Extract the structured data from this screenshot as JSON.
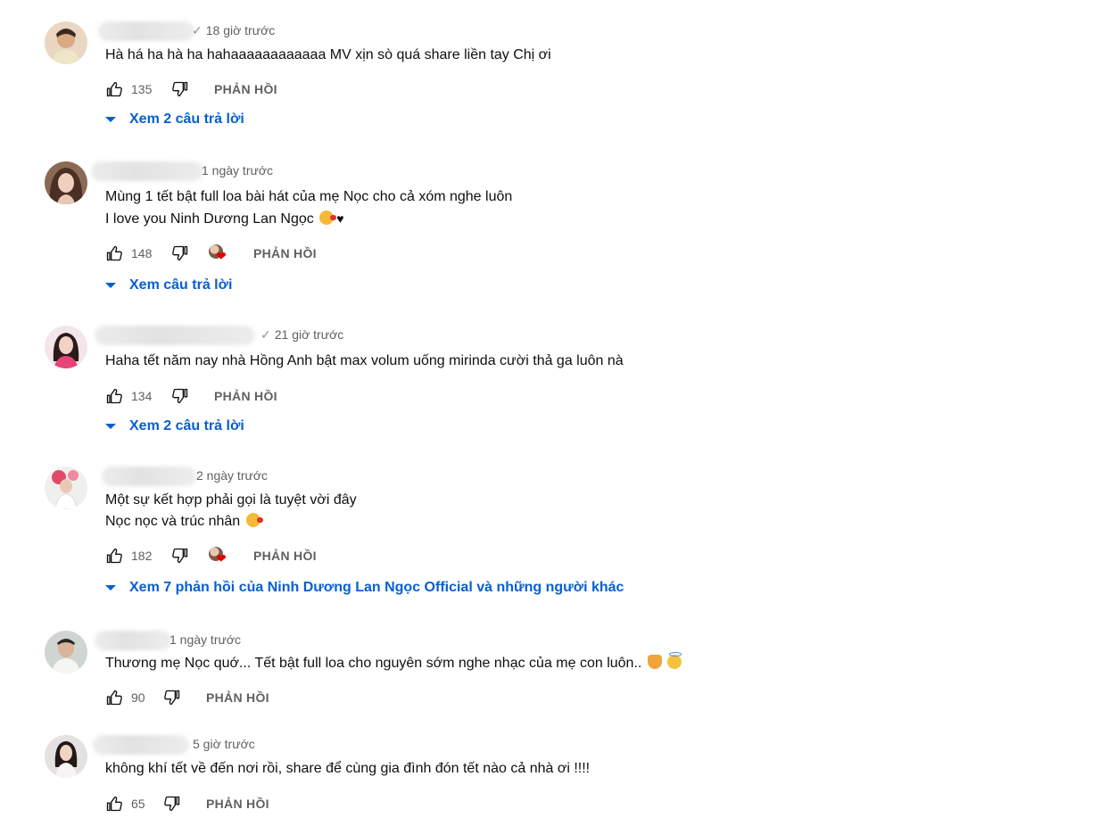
{
  "comments": [
    {
      "time": "18 giờ trước",
      "check": "✓",
      "lines": [
        "Hà há ha hà ha hahaaaaaaaaaaaa MV xịn sò quá share liền tay Chị ơi"
      ],
      "likes": "135",
      "reply_label": "PHẢN HỒI",
      "replies_label": "Xem 2 câu trả lời"
    },
    {
      "time": "1 ngày trước",
      "lines": [
        "Mùng 1 tết bật full loa bài hát của mẹ Nọc cho cả xóm nghe luôn",
        "I love you Ninh Dương Lan Ngọc"
      ],
      "likes": "148",
      "reply_label": "PHẢN HỒI",
      "replies_label": "Xem câu trả lời",
      "heart_glyph": "❤"
    },
    {
      "time": "21 giờ trước",
      "check": "✓",
      "lines": [
        "Haha tết năm nay nhà Hồng Anh bật max volum uống mirinda cười thả ga luôn nà"
      ],
      "likes": "134",
      "reply_label": "PHẢN HỒI",
      "replies_label": "Xem 2 câu trả lời"
    },
    {
      "time": "2 ngày trước",
      "lines": [
        "Một sự kết hợp phải gọi là tuyệt vời đây",
        "Nọc nọc và trúc nhân"
      ],
      "likes": "182",
      "reply_label": "PHẢN HỒI",
      "replies_label": "Xem 7 phản hồi của Ninh Dương Lan Ngọc Official và những người khác"
    },
    {
      "time": "1 ngày trước",
      "lines": [
        "Thương mẹ Nọc quớ... Tết bật full loa cho nguyên sớm nghe nhạc của mẹ con luôn.."
      ],
      "likes": "90",
      "reply_label": "PHẢN HỒI"
    },
    {
      "time": "5 giờ trước",
      "lines": [
        "không khí tết về đến nơi rồi, share để cùng gia đình đón tết nào cả nhà ơi !!!!"
      ],
      "likes": "65",
      "reply_label": "PHẢN HỒI"
    }
  ],
  "icons": {
    "like": "thumbs-up-icon",
    "dislike": "thumbs-down-icon",
    "expand": "caret-down-icon",
    "creator_heart": "creator-heart-icon"
  },
  "colors": {
    "link": "#065fd4",
    "secondary_text": "#606060",
    "heart": "#e00000"
  }
}
